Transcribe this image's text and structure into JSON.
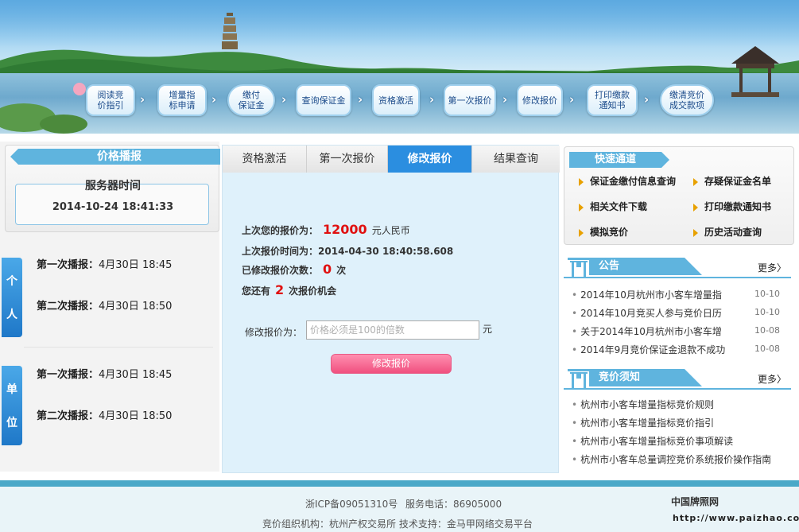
{
  "steps": [
    {
      "label": "阅读竞\n价指引"
    },
    {
      "label": "增量指\n标申请"
    },
    {
      "label": "缴付\n保证金"
    },
    {
      "label": "查询保证金"
    },
    {
      "label": "资格激活"
    },
    {
      "label": "第一次报价"
    },
    {
      "label": "修改报价"
    },
    {
      "label": "打印缴款\n通知书"
    },
    {
      "label": "缴清竞价\n成交款项"
    }
  ],
  "left": {
    "title": "价格播报",
    "server_label": "服务器时间",
    "server_time": "2014-10-24   18:41:33",
    "groups": [
      {
        "tag": [
          "个",
          "人"
        ],
        "rows": [
          {
            "label": "第一次播报：",
            "value": "4月30日  18:45"
          },
          {
            "label": "第二次播报：",
            "value": "4月30日  18:50"
          }
        ]
      },
      {
        "tag": [
          "单",
          "位"
        ],
        "rows": [
          {
            "label": "第一次播报：",
            "value": "4月30日  18:45"
          },
          {
            "label": "第二次播报：",
            "value": "4月30日  18:50"
          }
        ]
      }
    ]
  },
  "middle": {
    "tabs": [
      {
        "label": "资格激活",
        "active": false
      },
      {
        "label": "第一次报价",
        "active": false
      },
      {
        "label": "修改报价",
        "active": true
      },
      {
        "label": "结果查询",
        "active": false
      }
    ],
    "last_price_label": "上次您的报价为：",
    "last_price_value": "12000",
    "last_price_unit": "元人民币",
    "last_time_label": "上次报价时间为：",
    "last_time_value": "2014-04-30 18:40:58.608",
    "modified_label": "已修改报价次数：",
    "modified_value": "0",
    "modified_unit": "次",
    "remaining_prefix": "您还有",
    "remaining_value": "2",
    "remaining_suffix": "次报价机会",
    "modify_label": "修改报价为：",
    "modify_placeholder": "价格必须是100的倍数",
    "modify_unit": "元",
    "modify_button": "修改报价"
  },
  "right": {
    "quick_title": "快速通道",
    "quick_links": [
      "保证金缴付信息查询",
      "存疑保证金名单",
      "相关文件下载",
      "打印缴款通知书",
      "模拟竞价",
      "历史活动查询"
    ],
    "notice_title": "公告",
    "notice_more": "更多〉",
    "notices": [
      {
        "title": "2014年10月杭州市小客车增量指",
        "date": "10-10"
      },
      {
        "title": "2014年10月竞买人参与竞价日历",
        "date": "10-10"
      },
      {
        "title": "关于2014年10月杭州市小客车增",
        "date": "10-08"
      },
      {
        "title": "2014年9月竞价保证金退款不成功",
        "date": "10-08"
      }
    ],
    "rules_title": "竞价须知",
    "rules_more": "更多〉",
    "rules": [
      "杭州市小客车增量指标竞价规则",
      "杭州市小客车增量指标竞价指引",
      "杭州市小客车增量指标竞价事项解读",
      "杭州市小客车总量调控竞价系统报价操作指南"
    ]
  },
  "footer": {
    "icp": "浙ICP备09051310号",
    "phone": "服务电话：86905000",
    "org": "竞价组织机构：杭州产权交易所  技术支持：金马甲网络交易平台",
    "brand": "中国牌照网",
    "brand_url": "http://www.paizhao.com.cn"
  },
  "colors": {
    "accent": "#5fb4de",
    "tab_active": "#2b8ee0",
    "highlight_red": "#e01010",
    "button_pink": "#f0507f"
  }
}
